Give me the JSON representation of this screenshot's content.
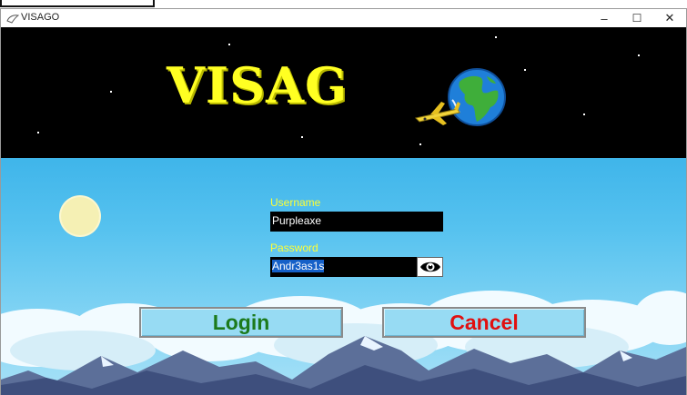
{
  "window": {
    "title": "VISAGO",
    "minimize_glyph": "–",
    "maximize_glyph": "☐",
    "close_glyph": "✕"
  },
  "banner": {
    "logo_text": "VISAG",
    "logo_color": "#ffff22",
    "globe_icon": "globe-icon",
    "plane_icon": "airplane-icon"
  },
  "form": {
    "username_label": "Username",
    "username_value": "Purpleaxe",
    "password_label": "Password",
    "password_value": "Andr3as1s",
    "show_password_icon": "eye-icon",
    "label_color": "#ffff33"
  },
  "buttons": {
    "login_label": "Login",
    "login_color": "#1c7a1c",
    "cancel_label": "Cancel",
    "cancel_color": "#e01010"
  }
}
